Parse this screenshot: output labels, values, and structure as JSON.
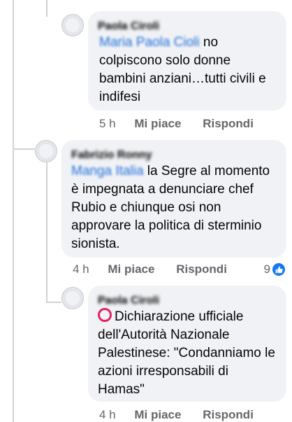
{
  "comments": [
    {
      "author": "Paola Ciroli",
      "mention": "Maria Paola Cioli",
      "text": " no colpiscono solo donne bambini anziani…tutti civili e indifesi",
      "time": "5 h",
      "like_label": "Mi piace",
      "reply_label": "Rispondi"
    },
    {
      "author": "Fabrizio Ronny",
      "mention": "Manga Italia",
      "text": " la Segre al momento è impegnata a denunciare chef Rubio e chiunque osi non approvare la politica di sterminio sionista.",
      "time": "4 h",
      "like_label": "Mi piace",
      "reply_label": "Rispondi",
      "reaction_count": "9",
      "reaction_icon": "thumbs-up-icon"
    },
    {
      "author": "Paola Ciroli",
      "text": "Dichiarazione ufficiale dell'Autorità Nazionale Palestinese: \"Condanniamo le azioni irresponsabili di Hamas\"",
      "leading_icon": "red-circle-icon",
      "time": "4 h",
      "like_label": "Mi piace",
      "reply_label": "Rispondi"
    }
  ],
  "colors": {
    "bubble": "#f0f2f5",
    "secondary_text": "#65676b",
    "mention": "#216fdb",
    "accent": "#1877f2"
  }
}
